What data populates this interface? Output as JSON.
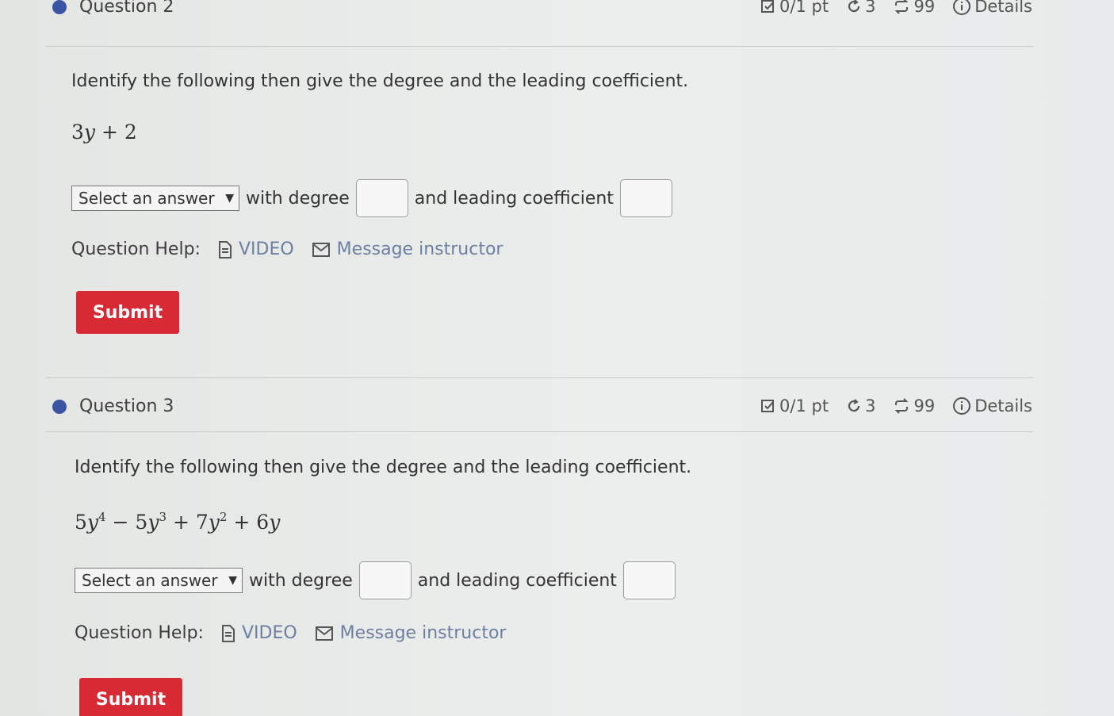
{
  "question2": {
    "header": {
      "title": "Question 2",
      "points": "0/1 pt",
      "attempts": "3",
      "tries": "99",
      "details": "Details"
    },
    "prompt": "Identify the following then give the degree and the leading coefficient.",
    "expression": "3y + 2",
    "select_placeholder": "Select an answer",
    "with_degree": "with degree",
    "and_leading": "and leading coefficient",
    "help_label": "Question Help:",
    "video_link": "VIDEO",
    "message_link": "Message instructor",
    "submit": "Submit"
  },
  "question3": {
    "header": {
      "title": "Question 3",
      "points": "0/1 pt",
      "attempts": "3",
      "tries": "99",
      "details": "Details"
    },
    "prompt": "Identify the following then give the degree and the leading coefficient.",
    "expression": "5y^4 − 5y^3 + 7y^2 + 6y",
    "select_placeholder": "Select an answer",
    "with_degree": "with degree",
    "and_leading": "and leading coefficient",
    "help_label": "Question Help:",
    "video_link": "VIDEO",
    "message_link": "Message instructor",
    "submit": "Submit"
  },
  "colors": {
    "accent_bullet": "#3a55a4",
    "submit_bg": "#d72a35",
    "link": "#6d7fa0"
  },
  "icons": [
    "edit-check-icon",
    "retry-icon",
    "loop-icon",
    "info-icon",
    "document-icon",
    "mail-icon",
    "chevron-down-icon"
  ]
}
